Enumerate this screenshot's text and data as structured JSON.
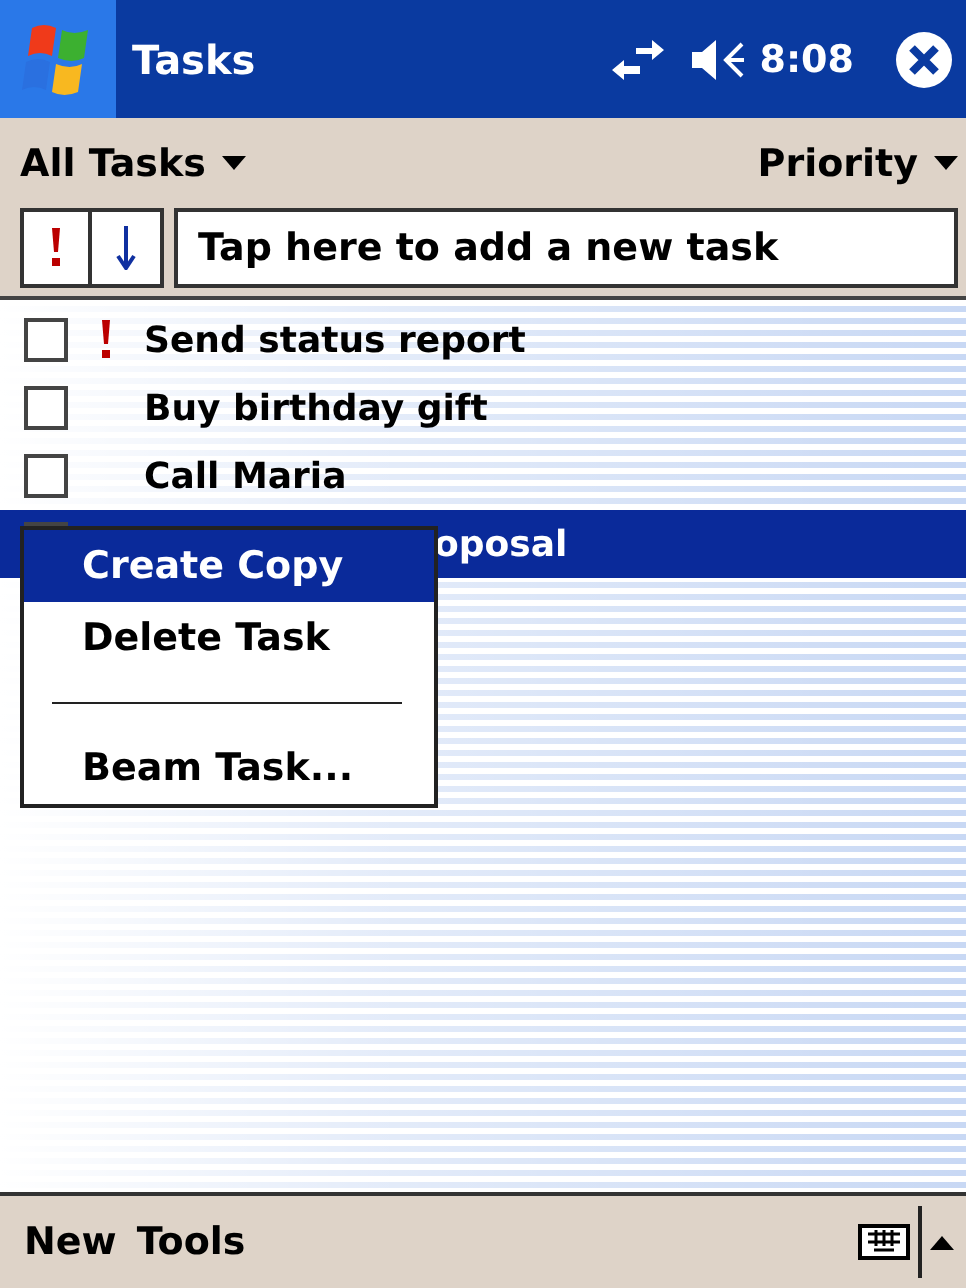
{
  "title_bar": {
    "title": "Tasks",
    "time": "8:08"
  },
  "toolbar": {
    "filter": "All Tasks",
    "sort": "Priority"
  },
  "new_task": {
    "placeholder": "Tap here to add a new task"
  },
  "tasks": [
    {
      "title": "Send status report",
      "checked": false,
      "high_priority": true,
      "selected": false,
      "covered": false
    },
    {
      "title": "Buy birthday gift",
      "checked": false,
      "high_priority": false,
      "selected": false,
      "covered": false
    },
    {
      "title": "Call Maria",
      "checked": false,
      "high_priority": false,
      "selected": false,
      "covered": false
    },
    {
      "title": "oposal",
      "high_priority": false,
      "selected": true,
      "covered": true
    }
  ],
  "context_menu": [
    {
      "kind": "item",
      "label": "Create Copy",
      "selected": true
    },
    {
      "kind": "item",
      "label": "Delete Task",
      "selected": false
    },
    {
      "kind": "separator"
    },
    {
      "kind": "item",
      "label": "Beam Task...",
      "selected": false
    }
  ],
  "menu_bar": {
    "items": [
      "New",
      "Tools"
    ]
  }
}
